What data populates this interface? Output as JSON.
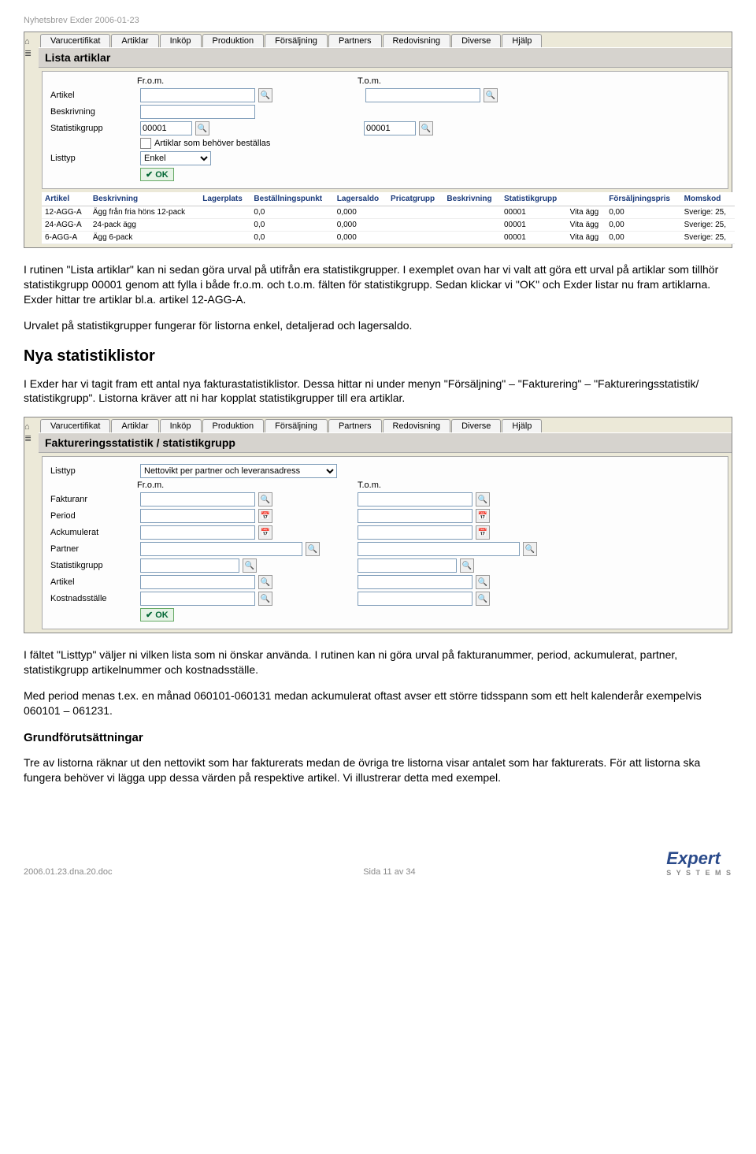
{
  "doc_header": "Nyhetsbrev Exder 2006-01-23",
  "tabs": [
    "Varucertifikat",
    "Artiklar",
    "Inköp",
    "Produktion",
    "Försäljning",
    "Partners",
    "Redovisning",
    "Diverse",
    "Hjälp"
  ],
  "screenshot1": {
    "title": "Lista artiklar",
    "from_label": "Fr.o.m.",
    "to_label": "T.o.m.",
    "labels": {
      "artikel": "Artikel",
      "beskrivning": "Beskrivning",
      "statgrupp": "Statistikgrupp",
      "check_label": "Artiklar som behöver beställas",
      "listtyp": "Listtyp"
    },
    "statgrupp_val": "00001",
    "listtyp_val": "Enkel",
    "ok": "OK",
    "table": {
      "headers": [
        "Artikel",
        "Beskrivning",
        "Lagerplats",
        "Beställningspunkt",
        "Lagersaldo",
        "Pricatgrupp",
        "Beskrivning",
        "Statistikgrupp",
        "",
        "Försäljningspris",
        "Momskod"
      ],
      "rows": [
        [
          "12-AGG-A",
          "Ägg från fria höns 12-pack",
          "",
          "0,0",
          "0,000",
          "",
          "",
          "00001",
          "Vita ägg",
          "0,00",
          "Sverige: 25,"
        ],
        [
          "24-AGG-A",
          "24-pack ägg",
          "",
          "0,0",
          "0,000",
          "",
          "",
          "00001",
          "Vita ägg",
          "0,00",
          "Sverige: 25,"
        ],
        [
          "6-AGG-A",
          "Ägg 6-pack",
          "",
          "0,0",
          "0,000",
          "",
          "",
          "00001",
          "Vita ägg",
          "0,00",
          "Sverige: 25,"
        ]
      ]
    }
  },
  "para1": "I rutinen \"Lista artiklar\" kan ni sedan göra urval på utifrån era statistikgrupper. I exemplet ovan har vi valt att göra ett urval på artiklar som tillhör statistikgrupp 00001 genom att fylla i både fr.o.m. och t.o.m. fälten för statistikgrupp. Sedan klickar vi \"OK\" och Exder listar nu fram artiklarna. Exder hittar tre artiklar bl.a. artikel 12-AGG-A.",
  "para2": "Urvalet på statistikgrupper fungerar för listorna enkel, detaljerad och lagersaldo.",
  "h2_1": "Nya statistiklistor",
  "para3": "I Exder har vi tagit fram ett antal nya fakturastatistiklistor. Dessa hittar ni under menyn \"Försäljning\" – \"Fakturering\" – \"Faktureringsstatistik/ statistikgrupp\". Listorna kräver att ni har kopplat statistikgrupper till era artiklar.",
  "screenshot2": {
    "title": "Faktureringsstatistik / statistikgrupp",
    "from_label": "Fr.o.m.",
    "to_label": "T.o.m.",
    "labels": {
      "listtyp": "Listtyp",
      "fakturanr": "Fakturanr",
      "period": "Period",
      "ackumulerat": "Ackumulerat",
      "partner": "Partner",
      "statgrupp": "Statistikgrupp",
      "artikel": "Artikel",
      "kostnad": "Kostnadsställe"
    },
    "listtyp_val": "Nettovikt per partner och leveransadress",
    "ok": "OK"
  },
  "para4": "I fältet \"Listtyp\" väljer ni vilken lista som ni önskar använda. I rutinen kan ni göra urval på fakturanummer, period, ackumulerat, partner, statistikgrupp artikelnummer och kostnadsställe.",
  "para5": "Med period menas t.ex. en månad 060101-060131 medan ackumulerat oftast avser ett större tidsspann som ett helt kalenderår exempelvis 060101 – 061231.",
  "h3_1": "Grundförutsättningar",
  "para6": "Tre av listorna räknar ut den nettovikt som har fakturerats medan de övriga tre listorna visar antalet som har fakturerats. För att listorna ska fungera behöver vi lägga upp dessa värden på respektive artikel. Vi illustrerar detta med exempel.",
  "footer_left": "2006.01.23.dna.20.doc",
  "footer_center": "Sida 11 av 34",
  "logo": "Expert",
  "logo_sub": "S Y S T E M S"
}
